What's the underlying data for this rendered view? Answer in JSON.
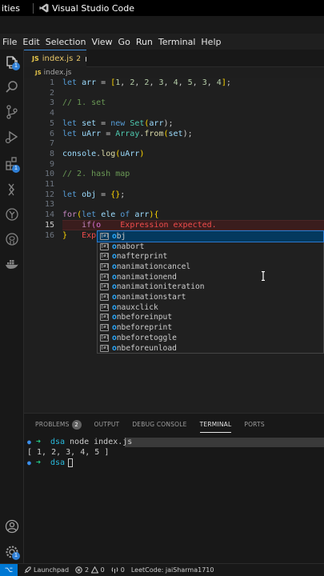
{
  "os_bar": {
    "left_app_label": "ities",
    "app_title": "Visual Studio Code"
  },
  "menu": [
    "File",
    "Edit",
    "Selection",
    "View",
    "Go",
    "Run",
    "Terminal",
    "Help"
  ],
  "activity": {
    "extensions_badge": "1",
    "explorer_badge": "1",
    "accounts_badge": "1"
  },
  "tab": {
    "js_badge": "JS",
    "name": "index.js",
    "problems": "2"
  },
  "breadcrumb": {
    "js_badge": "JS",
    "file": "index.js"
  },
  "editor": {
    "line_numbers": [
      "1",
      "2",
      "3",
      "4",
      "5",
      "6",
      "7",
      "8",
      "9",
      "10",
      "11",
      "12",
      "13",
      "14",
      "15",
      "16"
    ],
    "line1": {
      "kw": "let",
      "var": "arr",
      "eq": " = ",
      "open": "[",
      "nums": [
        "1",
        "2",
        "2",
        "3",
        "4",
        "5",
        "3",
        "4"
      ],
      "close": "]",
      "end": ";"
    },
    "line3": "// 1. set",
    "line5": {
      "kw": "let",
      "var": "set",
      "eq": " = ",
      "new": "new",
      "cls": "Set",
      "arg": "arr",
      "end": ");"
    },
    "line6": {
      "kw": "let",
      "var": "uArr",
      "eq": " = ",
      "cls": "Array",
      "fn": "from",
      "arg": "set",
      "end": ");"
    },
    "line8": {
      "obj": "console",
      "fn": "log",
      "arg": "uArr"
    },
    "line10": "// 2. hash map",
    "line12": {
      "kw": "let",
      "var": "obj",
      "eq": " = ",
      "val": "{}",
      "end": ";"
    },
    "line14": {
      "kw": "for",
      "kw2": "let",
      "var": "ele",
      "of": "of",
      "arr": "arr",
      "end": "){"
    },
    "line15": {
      "code": "if",
      "typed": "(o",
      "error": "Expression expected."
    },
    "line16": {
      "brace": "}",
      "error": "Exp"
    }
  },
  "suggestions": [
    {
      "match": "o",
      "rest": "bj",
      "selected": true
    },
    {
      "match": "o",
      "rest": "nabort"
    },
    {
      "match": "o",
      "rest": "nafterprint"
    },
    {
      "match": "o",
      "rest": "nanimationcancel"
    },
    {
      "match": "o",
      "rest": "nanimationend"
    },
    {
      "match": "o",
      "rest": "nanimationiteration"
    },
    {
      "match": "o",
      "rest": "nanimationstart"
    },
    {
      "match": "o",
      "rest": "nauxclick"
    },
    {
      "match": "o",
      "rest": "nbeforeinput"
    },
    {
      "match": "o",
      "rest": "nbeforeprint"
    },
    {
      "match": "o",
      "rest": "nbeforetoggle"
    },
    {
      "match": "o",
      "rest": "nbeforeunload"
    }
  ],
  "suggest_icon_text": "[ø]",
  "panel": {
    "tabs": [
      "PROBLEMS",
      "OUTPUT",
      "DEBUG CONSOLE",
      "TERMINAL",
      "PORTS"
    ],
    "problems_count": "2",
    "active_tab": "TERMINAL"
  },
  "terminal": {
    "line1_dir": "dsa",
    "line1_cmd": "node index.js",
    "line2": "[ 1, 2, 3, 4, 5 ]",
    "line3_dir": "dsa"
  },
  "statusbar": {
    "launchpad": "Launchpad",
    "errors": "2",
    "warnings": "0",
    "ports": "0",
    "leetcode": "LeetCode: jaiSharma1710"
  },
  "colors": {
    "accent": "#0078d4",
    "error": "#f14c4c",
    "selection": "#04395e"
  }
}
